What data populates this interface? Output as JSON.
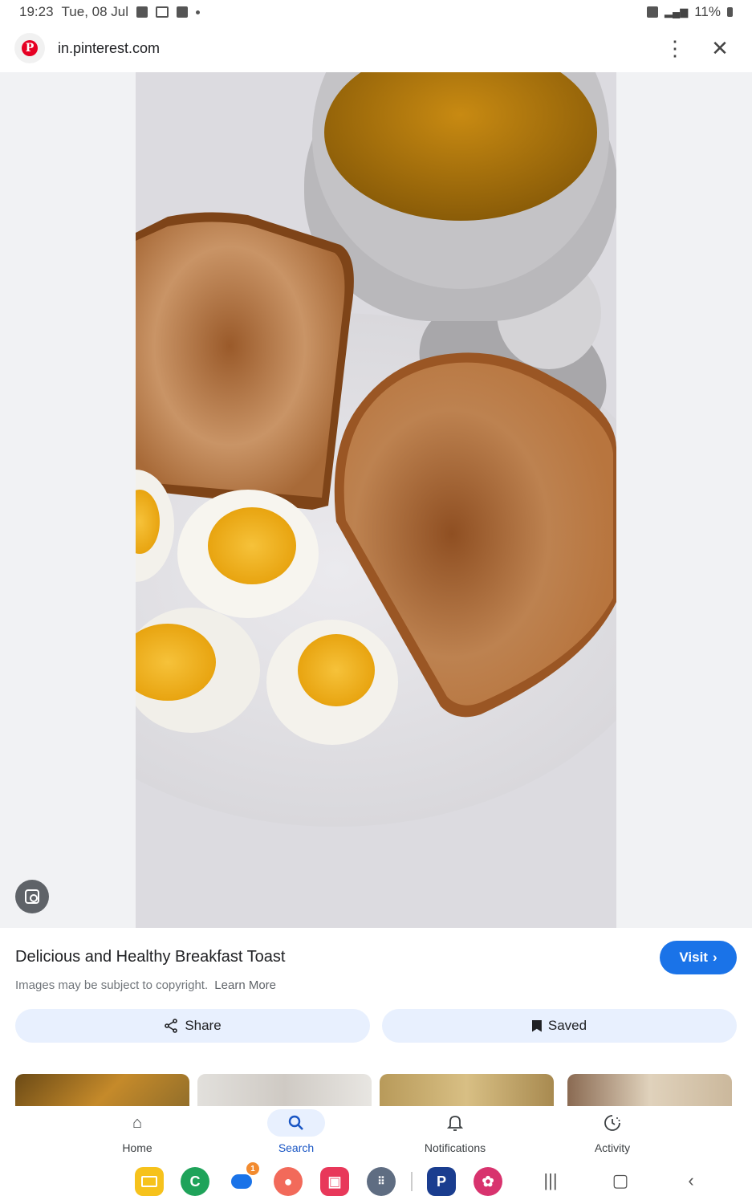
{
  "status_bar": {
    "time": "19:23",
    "date": "Tue, 08 Jul",
    "battery": "11%"
  },
  "url_bar": {
    "url": "in.pinterest.com",
    "logo_letter": "P"
  },
  "result": {
    "title": "Delicious and Healthy Breakfast Toast",
    "visit_label": "Visit",
    "copyright": "Images may be subject to copyright.",
    "learn_more": "Learn More",
    "share_label": "Share",
    "saved_label": "Saved"
  },
  "bottom_nav": {
    "items": [
      {
        "label": "Home",
        "icon": "home-icon"
      },
      {
        "label": "Search",
        "icon": "search-icon"
      },
      {
        "label": "Notifications",
        "icon": "bell-icon"
      },
      {
        "label": "Activity",
        "icon": "activity-icon"
      }
    ],
    "active": "Search"
  },
  "taskbar": {
    "messages_badge": "1"
  },
  "colors": {
    "accent": "#1a73e8",
    "pinterest": "#e60023"
  }
}
